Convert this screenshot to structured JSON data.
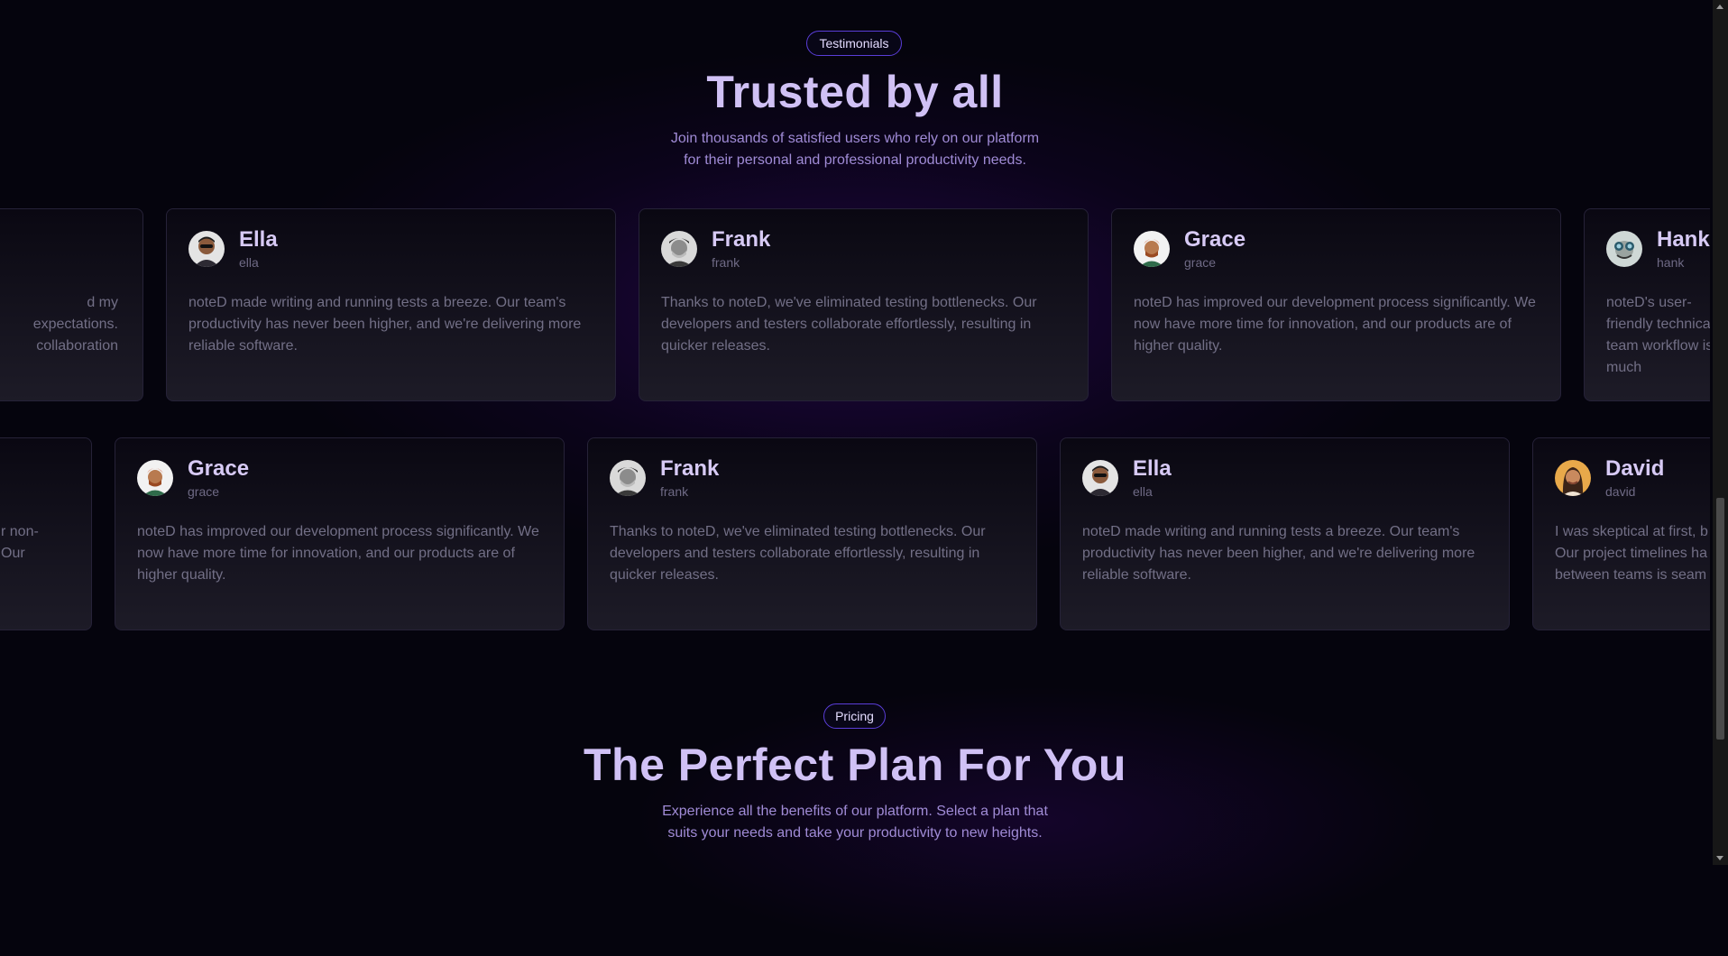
{
  "testimonials": {
    "badge": "Testimonials",
    "title": "Trusted by all",
    "subtitle_line1": "Join thousands of satisfied users who rely on our platform",
    "subtitle_line2": "for their personal and professional productivity needs.",
    "row1": [
      {
        "name": "",
        "handle": "",
        "quote": "d my expectations. collaboration",
        "avatar": "none"
      },
      {
        "name": "Ella",
        "handle": "ella",
        "quote": "noteD made writing and running tests a breeze. Our team's productivity has never been higher, and we're delivering more reliable software.",
        "avatar": "ella"
      },
      {
        "name": "Frank",
        "handle": "frank",
        "quote": "Thanks to noteD, we've eliminated testing bottlenecks. Our developers and testers collaborate effortlessly, resulting in quicker releases.",
        "avatar": "frank"
      },
      {
        "name": "Grace",
        "handle": "grace",
        "quote": "noteD has improved our development process significantly. We now have more time for innovation, and our products are of higher quality.",
        "avatar": "grace"
      },
      {
        "name": "Hank",
        "handle": "hank",
        "quote": "noteD's user-friendly technical team workflow is much",
        "avatar": "hank"
      }
    ],
    "row2": [
      {
        "name": "",
        "handle": "",
        "quote": "r non- Our",
        "avatar": "none"
      },
      {
        "name": "Grace",
        "handle": "grace",
        "quote": "noteD has improved our development process significantly. We now have more time for innovation, and our products are of higher quality.",
        "avatar": "grace"
      },
      {
        "name": "Frank",
        "handle": "frank",
        "quote": "Thanks to noteD, we've eliminated testing bottlenecks. Our developers and testers collaborate effortlessly, resulting in quicker releases.",
        "avatar": "frank"
      },
      {
        "name": "Ella",
        "handle": "ella",
        "quote": "noteD made writing and running tests a breeze. Our team's productivity has never been higher, and we're delivering more reliable software.",
        "avatar": "ella"
      },
      {
        "name": "David",
        "handle": "david",
        "quote": "I was skeptical at first, b Our project timelines ha between teams is seam",
        "avatar": "david"
      }
    ]
  },
  "pricing": {
    "badge": "Pricing",
    "title": "The Perfect Plan For You",
    "subtitle_line1": "Experience all the benefits of our platform. Select a plan that",
    "subtitle_line2": "suits your needs and take your productivity to new heights."
  },
  "colors": {
    "background": "#05040d",
    "accent_border": "#5a3dd8",
    "heading": "#d0c1f5",
    "subtitle": "#a08bd6",
    "card_text": "#726f86"
  }
}
